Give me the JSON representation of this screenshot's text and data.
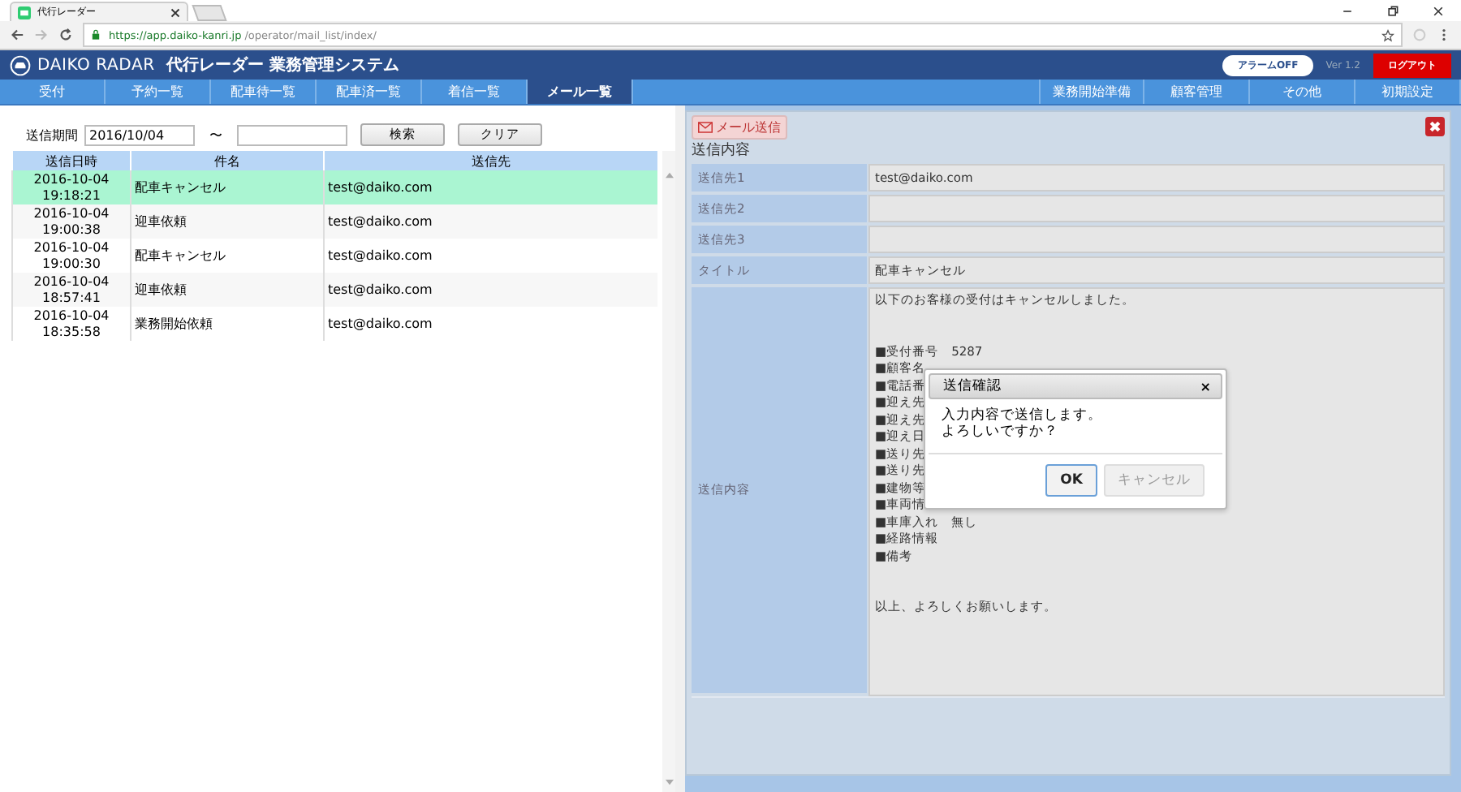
{
  "browser": {
    "tab_title": "代行レーダー",
    "url_host": "https://app.daiko-kanri.jp",
    "url_path": "/operator/mail_list/index/"
  },
  "header": {
    "logo": "DAIKO RADAR",
    "title": "代行レーダー 業務管理システム",
    "alarm_button": "アラームOFF",
    "version": "Ver 1.2",
    "logout_button": "ログアウト"
  },
  "nav": {
    "left": [
      {
        "label": "受付",
        "selected": false
      },
      {
        "label": "予約一覧",
        "selected": false
      },
      {
        "label": "配車待一覧",
        "selected": false
      },
      {
        "label": "配車済一覧",
        "selected": false
      },
      {
        "label": "着信一覧",
        "selected": false
      },
      {
        "label": "メール一覧",
        "selected": true
      }
    ],
    "right": [
      {
        "label": "業務開始準備",
        "selected": false
      },
      {
        "label": "顧客管理",
        "selected": false
      },
      {
        "label": "その他",
        "selected": false
      },
      {
        "label": "初期設定",
        "selected": false
      }
    ]
  },
  "search": {
    "label": "送信期間",
    "from": "2016/10/04",
    "separator": "〜",
    "buttons": [
      "検索",
      "クリア"
    ]
  },
  "table": {
    "columns": [
      "送信日時",
      "件名",
      "送信先"
    ],
    "rows": [
      {
        "date": "2016-10-04",
        "time": "19:18:21",
        "subject": "配車キャンセル",
        "to": "test@daiko.com",
        "selected": true
      },
      {
        "date": "2016-10-04",
        "time": "19:00:38",
        "subject": "迎車依頼",
        "to": "test@daiko.com",
        "selected": false
      },
      {
        "date": "2016-10-04",
        "time": "19:00:30",
        "subject": "配車キャンセル",
        "to": "test@daiko.com",
        "selected": false
      },
      {
        "date": "2016-10-04",
        "time": "18:57:41",
        "subject": "迎車依頼",
        "to": "test@daiko.com",
        "selected": false
      },
      {
        "date": "2016-10-04",
        "time": "18:35:58",
        "subject": "業務開始依頼",
        "to": "test@daiko.com",
        "selected": false
      }
    ]
  },
  "detail": {
    "send_button": "メール送信",
    "heading": "送信内容",
    "fields": [
      {
        "label": "送信先1",
        "value": "test@daiko.com"
      },
      {
        "label": "送信先2"
      },
      {
        "label": "送信先3"
      },
      {
        "label": "タイトル",
        "value": "配車キャンセル"
      }
    ],
    "body_label": "送信内容",
    "body_paragraphs": [
      [
        "以下のお客様の受付はキャンセルしました。"
      ],
      [
        "■受付番号　5287",
        "■顧客名",
        "■電話番",
        "■迎え先",
        "■迎え先",
        "■迎え日",
        "■送り先",
        "■送り先",
        "■建物等",
        "■車両情",
        "■車庫入れ　無し",
        "■経路情報",
        "■備考"
      ],
      [
        "以上、よろしくお願いします。"
      ]
    ]
  },
  "dialog": {
    "title": "送信確認",
    "close": "×",
    "message": [
      "入力内容で送信します。",
      "よろしいですか？"
    ],
    "buttons": [
      {
        "label": "OK",
        "kind": "primary"
      },
      {
        "label": "キャンセル",
        "kind": "secondary"
      }
    ]
  }
}
